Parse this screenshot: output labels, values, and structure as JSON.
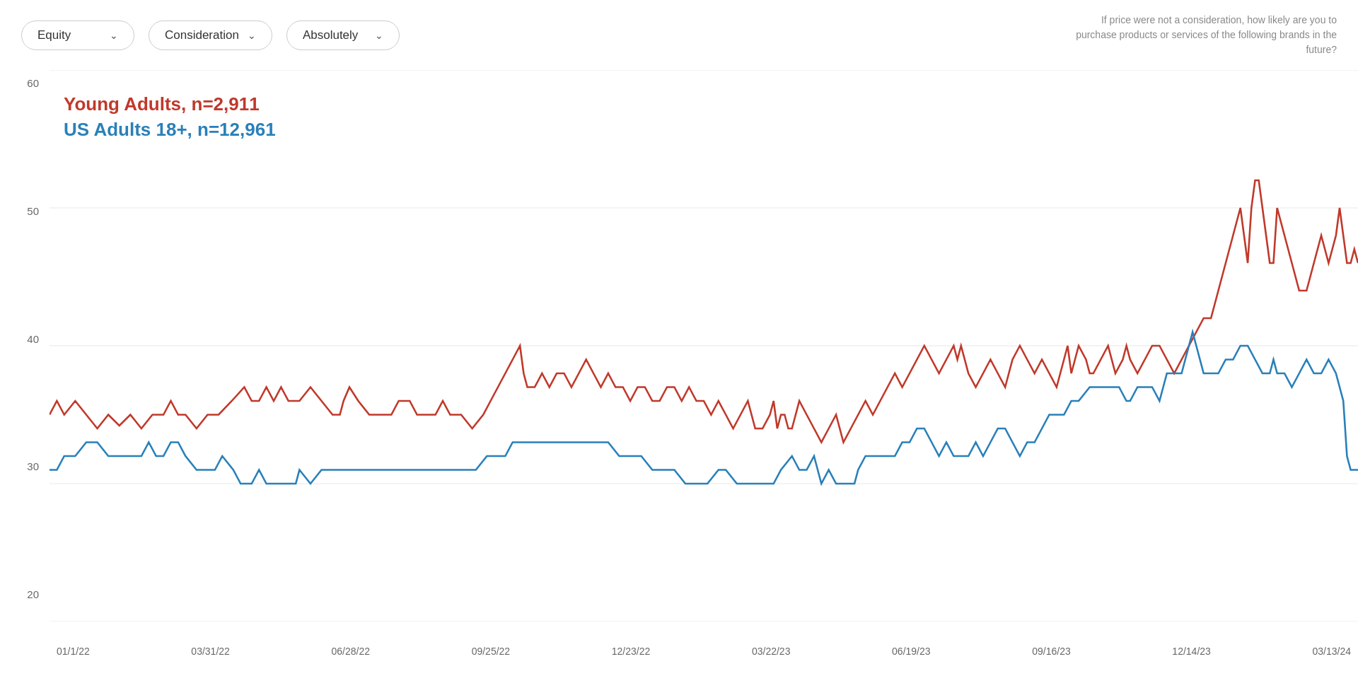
{
  "dropdowns": [
    {
      "label": "Equity",
      "id": "equity-dropdown"
    },
    {
      "label": "Consideration",
      "id": "consideration-dropdown"
    },
    {
      "label": "Absolutely",
      "id": "absolutely-dropdown"
    }
  ],
  "question": "If price were not a consideration, how likely are you to purchase products or services of the following brands in the future?",
  "legend": {
    "red_label": "Young Adults, n=2,911",
    "blue_label": "US Adults 18+, n=12,961"
  },
  "y_axis": {
    "labels": [
      "60",
      "50",
      "40",
      "30",
      "20"
    ],
    "min": 20,
    "max": 60
  },
  "x_axis": {
    "labels": [
      "01/1/22",
      "03/31/22",
      "06/28/22",
      "09/25/22",
      "12/23/22",
      "03/22/23",
      "06/19/23",
      "09/16/23",
      "12/14/23",
      "03/13/24"
    ]
  },
  "colors": {
    "red": "#c0392b",
    "blue": "#2980b9",
    "grid": "#e8e8e8",
    "background": "#ffffff"
  }
}
